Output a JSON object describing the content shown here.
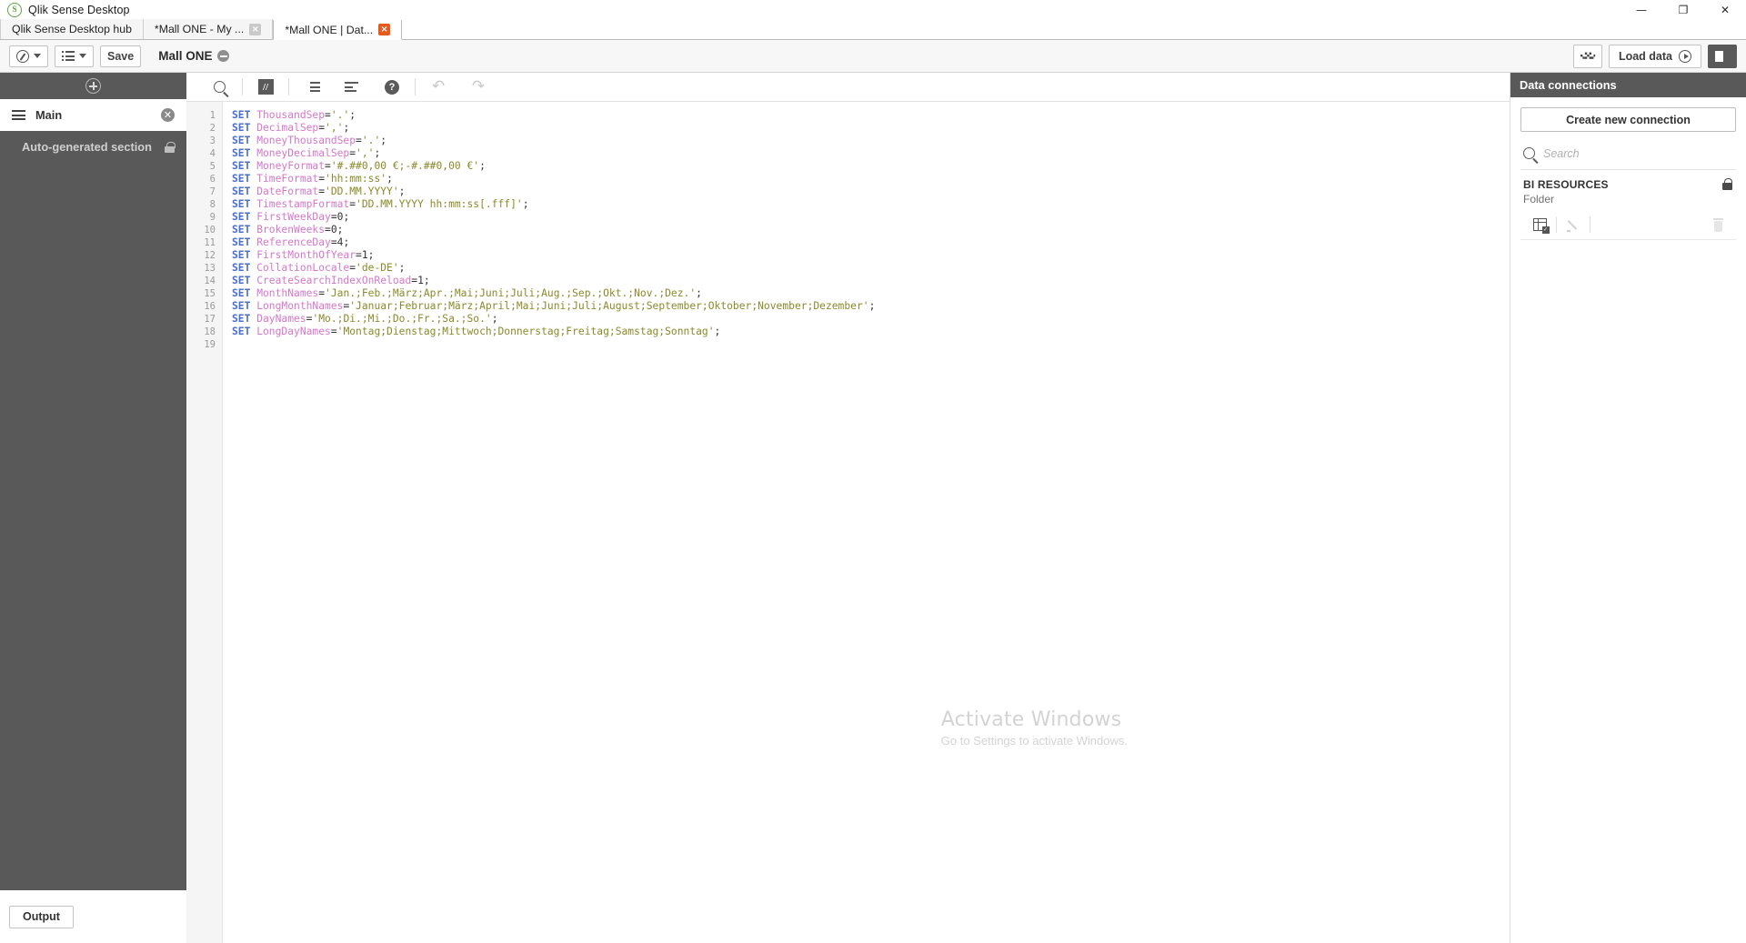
{
  "window": {
    "title": "Qlik Sense Desktop",
    "logo_glyph": "S",
    "minimize": "—",
    "maximize": "❐",
    "close": "✕"
  },
  "tabs": [
    {
      "label": "Qlik Sense Desktop hub",
      "closable": false,
      "active": false
    },
    {
      "label": "*Mall ONE - My ...",
      "closable": true,
      "active": false,
      "close_glyph": "×"
    },
    {
      "label": "*Mall ONE | Dat...",
      "closable": true,
      "active": true,
      "close_glyph": "×"
    }
  ],
  "toolbar": {
    "nav_label": "",
    "sheet_label": "",
    "save_label": "Save",
    "app_title": "Mall ONE",
    "smart_search_label": "",
    "load_data_label": "Load data",
    "panel_toggle_label": ""
  },
  "sidebar": {
    "add_section_label": "",
    "items": [
      {
        "label": "Main",
        "selected": true,
        "closable": true,
        "close_glyph": "✕"
      },
      {
        "label": "Auto-generated section",
        "selected": false,
        "locked": true
      }
    ],
    "output_label": "Output"
  },
  "editor": {
    "toolbar": [
      {
        "name": "search-icon",
        "label": ""
      },
      {
        "name": "comment-icon",
        "label": "//"
      },
      {
        "name": "indent-icon",
        "label": ""
      },
      {
        "name": "outdent-icon",
        "label": ""
      },
      {
        "name": "help-icon",
        "label": "?"
      },
      {
        "name": "undo-icon",
        "label": "↶"
      },
      {
        "name": "redo-icon",
        "label": "↷"
      }
    ],
    "line_numbers": [
      "1",
      "2",
      "3",
      "4",
      "5",
      "6",
      "7",
      "8",
      "9",
      "10",
      "11",
      "12",
      "13",
      "14",
      "15",
      "16",
      "17",
      "18",
      "19"
    ],
    "lines": [
      {
        "kw": "SET",
        "var": " ThousandSep",
        "rest": "='.';"
      },
      {
        "kw": "SET",
        "var": " DecimalSep",
        "rest": "=',';"
      },
      {
        "kw": "SET",
        "var": " MoneyThousandSep",
        "rest": "='.';"
      },
      {
        "kw": "SET",
        "var": " MoneyDecimalSep",
        "rest": "=',';"
      },
      {
        "kw": "SET",
        "var": " MoneyFormat",
        "rest": "='#.##0,00 €;-#.##0,00 €';"
      },
      {
        "kw": "SET",
        "var": " TimeFormat",
        "rest": "='hh:mm:ss';"
      },
      {
        "kw": "SET",
        "var": " DateFormat",
        "rest": "='DD.MM.YYYY';"
      },
      {
        "kw": "SET",
        "var": " TimestampFormat",
        "rest": "='DD.MM.YYYY hh:mm:ss[.fff]';"
      },
      {
        "kw": "SET",
        "var": " FirstWeekDay",
        "rest": "=0;"
      },
      {
        "kw": "SET",
        "var": " BrokenWeeks",
        "rest": "=0;"
      },
      {
        "kw": "SET",
        "var": " ReferenceDay",
        "rest": "=4;"
      },
      {
        "kw": "SET",
        "var": " FirstMonthOfYear",
        "rest": "=1;"
      },
      {
        "kw": "SET",
        "var": " CollationLocale",
        "rest": "='de-DE';"
      },
      {
        "kw": "SET",
        "var": " CreateSearchIndexOnReload",
        "rest": "=1;"
      },
      {
        "kw": "SET",
        "var": " MonthNames",
        "rest": "='Jan.;Feb.;März;Apr.;Mai;Juni;Juli;Aug.;Sep.;Okt.;Nov.;Dez.';"
      },
      {
        "kw": "SET",
        "var": " LongMonthNames",
        "rest": "='Januar;Februar;März;April;Mai;Juni;Juli;August;September;Oktober;November;Dezember';"
      },
      {
        "kw": "SET",
        "var": " DayNames",
        "rest": "='Mo.;Di.;Mi.;Do.;Fr.;Sa.;So.';"
      },
      {
        "kw": "SET",
        "var": " LongDayNames",
        "rest": "='Montag;Dienstag;Mittwoch;Donnerstag;Freitag;Samstag;Sonntag';"
      },
      {
        "kw": "",
        "var": "",
        "rest": ""
      }
    ]
  },
  "right_panel": {
    "header": "Data connections",
    "create_button": "Create new connection",
    "search_placeholder": "Search",
    "connections": [
      {
        "name": "BI RESOURCES",
        "type": "Folder",
        "locked": true
      }
    ]
  },
  "watermark": {
    "line1": "Activate Windows",
    "line2": "Go to Settings to activate Windows."
  },
  "colors": {
    "accent_orange": "#e8591e",
    "brand_green": "#61a33f",
    "panel_dark": "#595959",
    "keyword": "#4a6fd4",
    "variable": "#d478c9",
    "string": "#8a8a2c"
  }
}
